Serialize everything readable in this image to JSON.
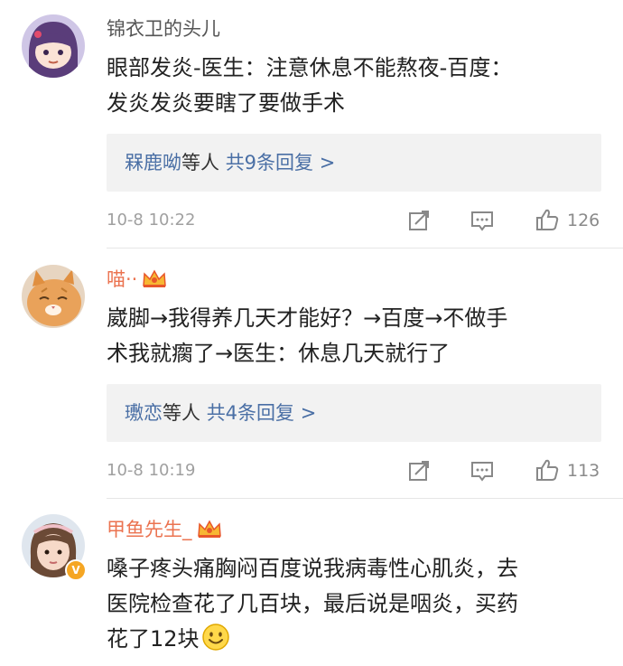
{
  "comments": [
    {
      "username": "锦衣卫的头儿",
      "text_line1": "眼部发炎-医生：注意休息不能熬夜-百度：",
      "text_line2": "发炎发炎要瞎了要做手术",
      "reply_names": "槑鹿呦",
      "reply_mid": "等人 ",
      "reply_count": "共9条回复 >",
      "time": "10-8 10:22",
      "likes": "126"
    },
    {
      "username": "喵··",
      "text_line1": "崴脚→我得养几天才能好？→百度→不做手",
      "text_line2": "术我就瘸了→医生：休息几天就行了",
      "reply_names": "璷恋",
      "reply_mid": "等人 ",
      "reply_count": "共4条回复 >",
      "time": "10-8 10:19",
      "likes": "113"
    },
    {
      "username": "甲鱼先生_",
      "text_line1": "嗓子疼头痛胸闷百度说我病毒性心肌炎，去",
      "text_line2": "医院检查花了几百块，最后说是咽炎，买药",
      "text_line3": "花了12块"
    }
  ],
  "icons": {
    "repost": "repost-icon",
    "comment": "comment-icon",
    "like": "thumbs-up-icon",
    "vip": "crown-icon",
    "verified": "verified-badge-icon",
    "emoji": "smile-emoji-icon"
  },
  "colors": {
    "vip_name": "#eb7350",
    "link": "#4a6fa5",
    "meta": "#a0a0a0",
    "reply_bg": "#f2f2f2"
  }
}
